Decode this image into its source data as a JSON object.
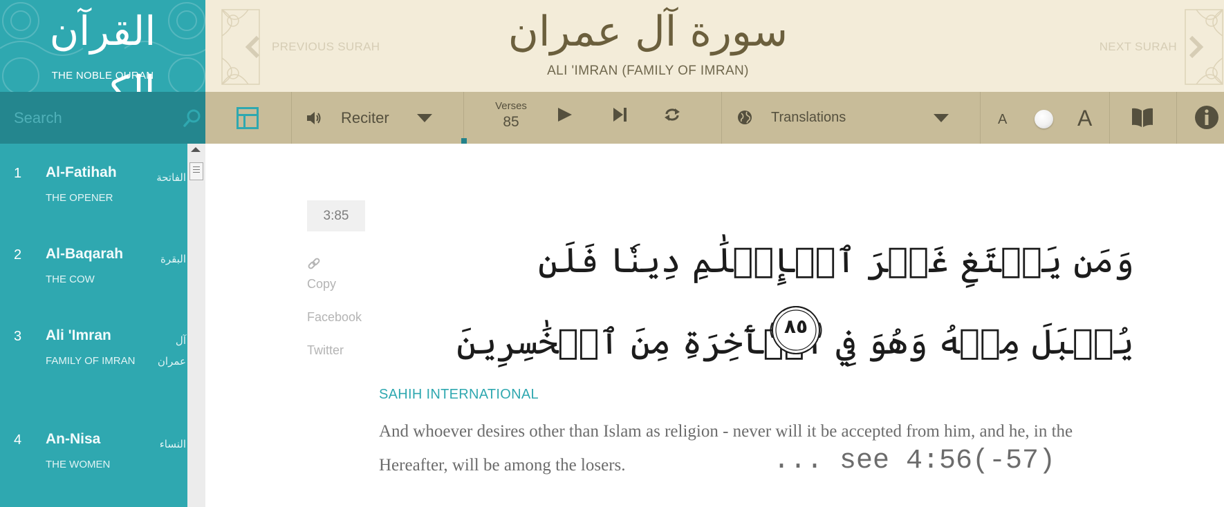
{
  "app": {
    "logo_arabic": "القرآن الكريم",
    "logo_subtitle": "THE NOBLE QURAN"
  },
  "search": {
    "placeholder": "Search",
    "value": ""
  },
  "header": {
    "previous_label": "PREVIOUS SURAH",
    "next_label": "NEXT SURAH",
    "surah_title_arabic": "سورة آل عمران",
    "surah_title_english": "ALI 'IMRAN (FAMILY OF IMRAN)"
  },
  "toolbar": {
    "reciter_label": "Reciter",
    "verses_label": "Verses",
    "verses_count": "85",
    "translations_label": "Translations",
    "font_small_label": "A",
    "font_large_label": "A",
    "audio_progress": 0.0
  },
  "sidebar": {
    "surahs": [
      {
        "number": "1",
        "name": "Al-Fatihah",
        "meaning": "THE OPENER",
        "arabic": "الفاتحة"
      },
      {
        "number": "2",
        "name": "Al-Baqarah",
        "meaning": "THE COW",
        "arabic": "البقرة"
      },
      {
        "number": "3",
        "name": "Ali 'Imran",
        "meaning": "FAMILY OF IMRAN",
        "arabic": "آل عمران"
      },
      {
        "number": "4",
        "name": "An-Nisa",
        "meaning": "THE WOMEN",
        "arabic": "النساء"
      }
    ]
  },
  "verse": {
    "reference": "3:85",
    "arabic_text": "وَمَن يَبۡتَغِ غَيۡرَ ٱلۡإِسۡلَٰمِ دِينٗا فَلَن يُقۡبَلَ مِنۡهُ وَهُوَ فِي ٱلۡأٓخِرَةِ مِنَ ٱلۡخَٰسِرِينَ",
    "ayah_number_arabic": "٨٥",
    "share": {
      "copy": "Copy",
      "facebook": "Facebook",
      "twitter": "Twitter"
    },
    "translation_name": "SAHIH INTERNATIONAL",
    "translation_text": "And whoever desires other than Islam as religion - never will it be accepted from him, and he, in the Hereafter, will be among the losers.",
    "annotation": "... see 4:56(-57)"
  },
  "colors": {
    "teal": "#2fa8b0",
    "teal_dark": "#24868e",
    "header_bg": "#f3ecd9",
    "toolbar_bg": "#c8bc99",
    "toolbar_text": "#55503e"
  },
  "icons": {
    "search": "search-icon",
    "layout": "layout-icon",
    "speaker": "speaker-icon",
    "play": "play-icon",
    "skip": "skip-next-icon",
    "repeat": "repeat-icon",
    "globe": "globe-icon",
    "book": "book-icon",
    "info": "info-icon",
    "link": "link-icon"
  }
}
